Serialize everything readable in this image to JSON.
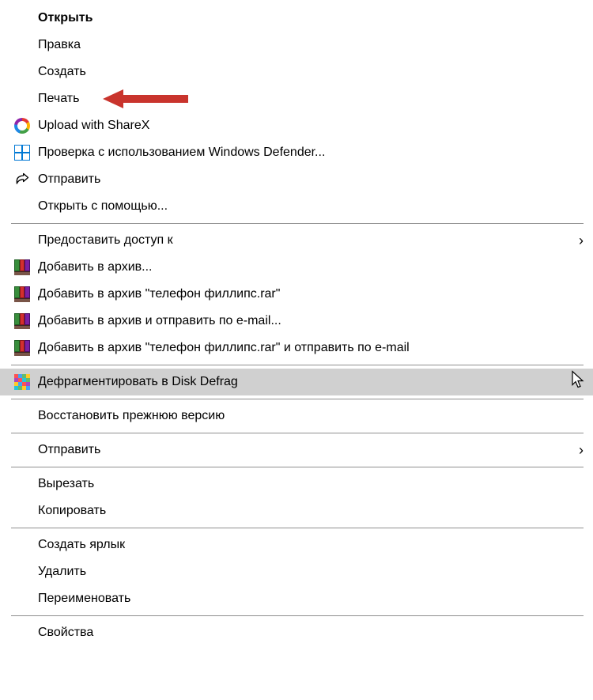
{
  "menu": {
    "open": "Открыть",
    "edit": "Правка",
    "create": "Создать",
    "print": "Печать",
    "upload_sharex": "Upload with ShareX",
    "defender_scan": "Проверка с использованием Windows Defender...",
    "share_system": "Отправить",
    "open_with": "Открыть с помощью...",
    "give_access": "Предоставить доступ к",
    "add_to_archive": "Добавить в архив...",
    "add_to_named_archive": "Добавить в архив \"телефон филлипс.rar\"",
    "archive_and_email": "Добавить в архив и отправить по e-mail...",
    "named_archive_and_email": "Добавить в архив \"телефон филлипс.rar\" и отправить по e-mail",
    "defrag": "Дефрагментировать в Disk Defrag",
    "restore_previous": "Восстановить прежнюю версию",
    "send_to": "Отправить",
    "cut": "Вырезать",
    "copy": "Копировать",
    "create_shortcut": "Создать ярлык",
    "delete": "Удалить",
    "rename": "Переименовать",
    "properties": "Свойства"
  }
}
